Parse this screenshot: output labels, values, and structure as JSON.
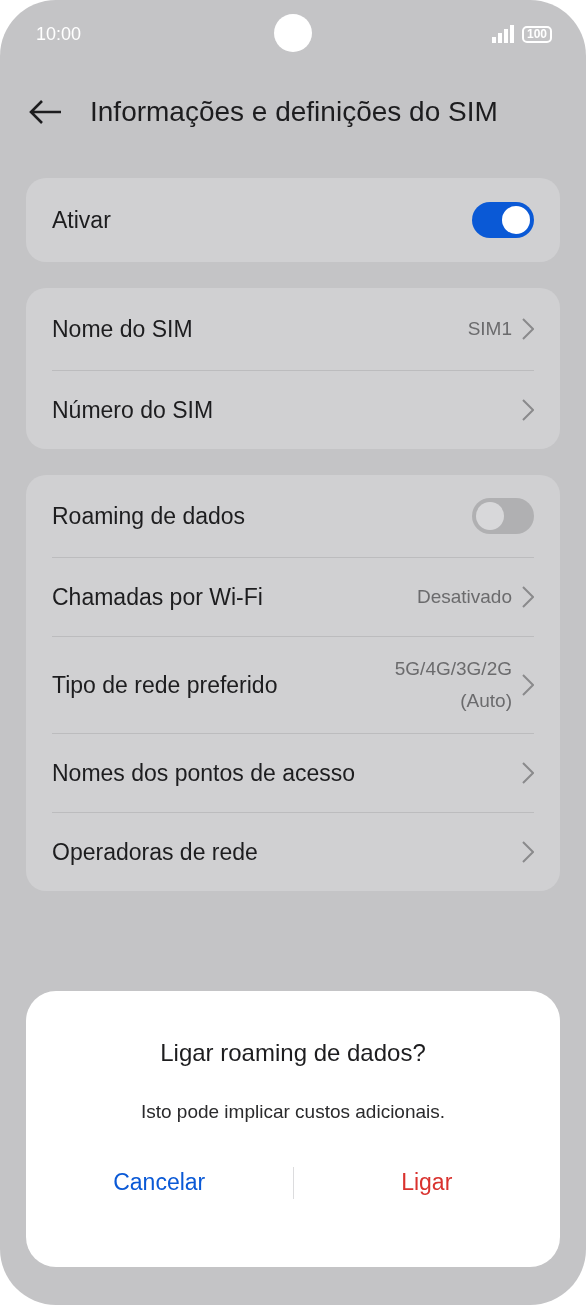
{
  "status_bar": {
    "time": "10:00",
    "battery": "100"
  },
  "header": {
    "title": "Informações e definições do SIM"
  },
  "groups": [
    {
      "rows": [
        {
          "kind": "toggle",
          "label": "Ativar",
          "on": true
        }
      ]
    },
    {
      "rows": [
        {
          "kind": "link",
          "label": "Nome do SIM",
          "value": "SIM1"
        },
        {
          "kind": "link",
          "label": "Número do SIM"
        }
      ]
    },
    {
      "rows": [
        {
          "kind": "toggle",
          "label": "Roaming de dados",
          "on": false
        },
        {
          "kind": "link",
          "label": "Chamadas por Wi-Fi",
          "value": "Desativado"
        },
        {
          "kind": "link",
          "label": "Tipo de rede preferido",
          "value": "5G/4G/3G/2G\n(Auto)"
        },
        {
          "kind": "link",
          "label": "Nomes dos pontos de acesso"
        },
        {
          "kind": "link",
          "label": "Operadoras de rede"
        }
      ]
    }
  ],
  "dialog": {
    "title": "Ligar roaming de dados?",
    "message": "Isto pode implicar custos adicionais.",
    "buttons": [
      {
        "label": "Cancelar",
        "kind": "cancel"
      },
      {
        "label": "Ligar",
        "kind": "confirm"
      }
    ]
  }
}
